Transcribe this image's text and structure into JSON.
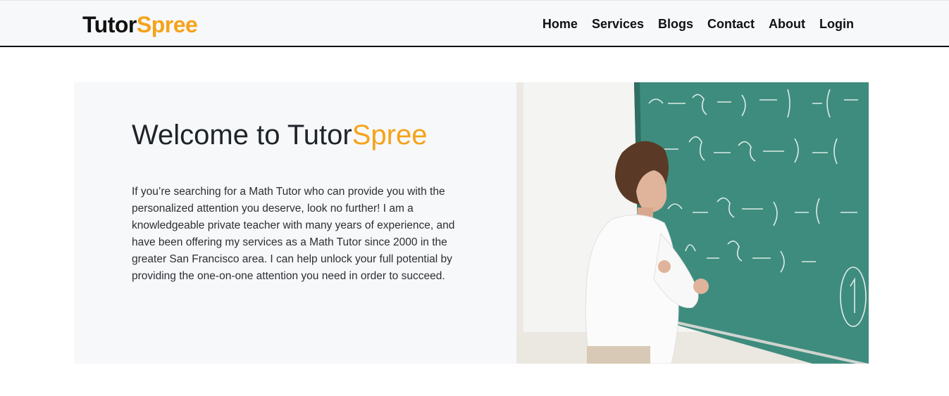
{
  "brand": {
    "name_part1": "Tutor",
    "name_part2": "Spree",
    "accent_color": "#f5a31a"
  },
  "nav": {
    "items": [
      {
        "label": "Home"
      },
      {
        "label": "Services"
      },
      {
        "label": "Blogs"
      },
      {
        "label": "Contact"
      },
      {
        "label": "About"
      },
      {
        "label": "Login"
      }
    ]
  },
  "hero": {
    "title_prefix": "Welcome to Tutor",
    "title_accent": "Spree",
    "paragraph": "If you’re searching for a Math Tutor who can provide you with the personalized attention you deserve, look no further! I am a knowledgeable private teacher with many years of experience, and have been offering my services as a Math Tutor since 2000 in the greater San Francisco area. I can help unlock your full potential by providing the one-on-one attention you need in order to succeed.",
    "image": {
      "description_icon": "teacher-at-chalkboard-illustration",
      "board_color": "#3e8c7e"
    }
  }
}
